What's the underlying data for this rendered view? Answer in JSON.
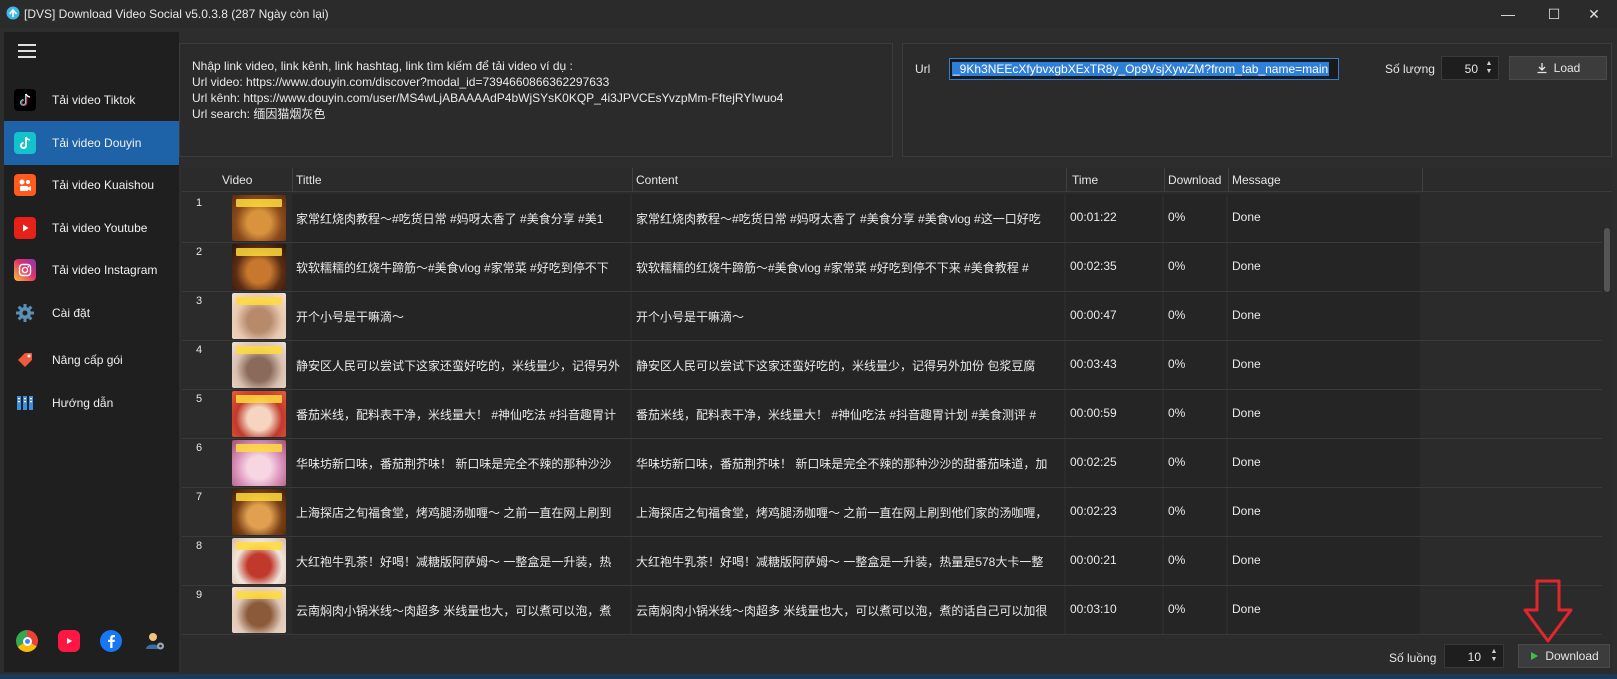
{
  "window": {
    "title": "[DVS] Download Video Social v5.0.3.8 (287 Ngày còn lại)",
    "minimize_glyph": "—",
    "maximize_glyph": "☐",
    "close_glyph": "✕"
  },
  "sidebar": {
    "items": [
      {
        "label": "Tải video Tiktok",
        "icon": "tiktok-icon",
        "active": false
      },
      {
        "label": "Tải video Douyin",
        "icon": "douyin-icon",
        "active": true
      },
      {
        "label": "Tải video Kuaishou",
        "icon": "kuaishou-icon",
        "active": false
      },
      {
        "label": "Tải video Youtube",
        "icon": "youtube-icon",
        "active": false
      },
      {
        "label": "Tải video Instagram",
        "icon": "instagram-icon",
        "active": false
      },
      {
        "label": "Cài đặt",
        "icon": "gear-icon",
        "active": false
      },
      {
        "label": "Nâng cấp gói",
        "icon": "upgrade-icon",
        "active": false
      },
      {
        "label": "Hướng dẫn",
        "icon": "guide-icon",
        "active": false
      }
    ]
  },
  "instructions": {
    "line1": "Nhập link video, link kênh, link hashtag, link tìm kiếm để tải video ví dụ :",
    "line2": "Url video: https://www.douyin.com/discover?modal_id=7394660866362297633",
    "line3": "Url kênh: https://www.douyin.com/user/MS4wLjABAAAAdP4bWjSYsK0KQP_4i3JPVCEsYvzpMm-FftejRYIwuo4",
    "line4": "Url search: 缅因猫烟灰色"
  },
  "url_panel": {
    "label": "Url",
    "value": "_9Kh3NEEcXfybvxgbXExTR8y_Op9VsjXywZM?from_tab_name=main",
    "qty_label": "Số lượng",
    "qty_value": "50",
    "load_label": "Load"
  },
  "table": {
    "headers": [
      "Video",
      "Tittle",
      "Content",
      "Time",
      "Download",
      "Message"
    ],
    "rows": [
      {
        "num": "1",
        "title": "家常红烧肉教程～#吃货日常 #妈呀太香了 #美食分享 #美1",
        "content": "家常红烧肉教程～#吃货日常 #妈呀太香了 #美食分享 #美食vlog #这一口好吃",
        "time": "00:01:22",
        "download": "0%",
        "message": "Done"
      },
      {
        "num": "2",
        "title": "软软糯糯的红烧牛蹄筋～#美食vlog #家常菜 #好吃到停不下",
        "content": "软软糯糯的红烧牛蹄筋～#美食vlog #家常菜 #好吃到停不下来 #美食教程 #",
        "time": "00:02:35",
        "download": "0%",
        "message": "Done"
      },
      {
        "num": "3",
        "title": "开个小号是干嘛滴～",
        "content": "开个小号是干嘛滴～",
        "time": "00:00:47",
        "download": "0%",
        "message": "Done"
      },
      {
        "num": "4",
        "title": "静安区人民可以尝试下这家还蛮好吃的，米线量少，记得另外",
        "content": "静安区人民可以尝试下这家还蛮好吃的，米线量少，记得另外加份 包浆豆腐",
        "time": "00:03:43",
        "download": "0%",
        "message": "Done"
      },
      {
        "num": "5",
        "title": "番茄米线，配料表干净，米线量大！ #神仙吃法 #抖音趣胃计",
        "content": "番茄米线，配料表干净，米线量大！ #神仙吃法 #抖音趣胃计划 #美食测评 #",
        "time": "00:00:59",
        "download": "0%",
        "message": "Done"
      },
      {
        "num": "6",
        "title": "华味坊新口味，番茄荆芥味！ 新口味是完全不辣的那种沙沙",
        "content": "华味坊新口味，番茄荆芥味！ 新口味是完全不辣的那种沙沙的甜番茄味道，加",
        "time": "00:02:25",
        "download": "0%",
        "message": "Done"
      },
      {
        "num": "7",
        "title": "上海探店之旬福食堂，烤鸡腿汤咖喱～ 之前一直在网上刷到",
        "content": "上海探店之旬福食堂，烤鸡腿汤咖喱～ 之前一直在网上刷到他们家的汤咖喱，",
        "time": "00:02:23",
        "download": "0%",
        "message": "Done"
      },
      {
        "num": "8",
        "title": "大红袍牛乳茶！好喝！减糖版阿萨姆～ 一整盒是一升装，热",
        "content": "大红袍牛乳茶！好喝！减糖版阿萨姆～ 一整盒是一升装，热量是578大卡一整",
        "time": "00:00:21",
        "download": "0%",
        "message": "Done"
      },
      {
        "num": "9",
        "title": "云南焖肉小锅米线～肉超多 米线量也大，可以煮可以泡，煮",
        "content": "云南焖肉小锅米线～肉超多 米线量也大，可以煮可以泡，煮的话自己可以加很",
        "time": "00:03:10",
        "download": "0%",
        "message": "Done"
      }
    ]
  },
  "footer": {
    "sl_label": "Số luồng",
    "sl_value": "10",
    "download_label": "Download"
  },
  "colors": {
    "accent": "#1e63a8",
    "annotation_arrow": "#e3262b",
    "play_icon": "#39c24a"
  }
}
